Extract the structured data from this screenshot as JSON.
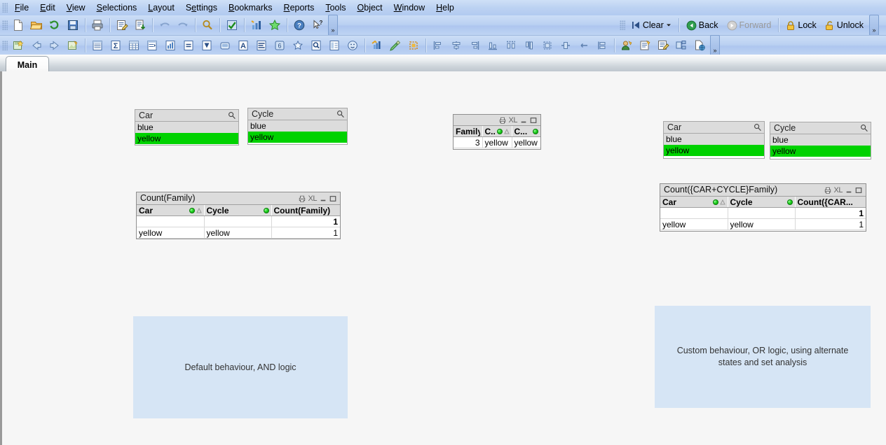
{
  "menubar": {
    "items": [
      {
        "label": "File",
        "accel": "F"
      },
      {
        "label": "Edit",
        "accel": "E"
      },
      {
        "label": "View",
        "accel": "V"
      },
      {
        "label": "Selections",
        "accel": "S"
      },
      {
        "label": "Layout",
        "accel": "L"
      },
      {
        "label": "Settings",
        "accel": "S"
      },
      {
        "label": "Bookmarks",
        "accel": "B"
      },
      {
        "label": "Reports",
        "accel": "R"
      },
      {
        "label": "Tools",
        "accel": "T"
      },
      {
        "label": "Object",
        "accel": "O"
      },
      {
        "label": "Window",
        "accel": "W"
      },
      {
        "label": "Help",
        "accel": "H"
      }
    ]
  },
  "toolbar_standard": {
    "buttons": [
      {
        "name": "new-document-icon",
        "title": "New"
      },
      {
        "name": "open-document-icon",
        "title": "Open"
      },
      {
        "name": "reload-icon",
        "title": "Reload"
      },
      {
        "name": "save-icon",
        "title": "Save"
      },
      {
        "name": "print-icon",
        "title": "Print"
      },
      {
        "name": "edit-script-icon",
        "title": "Edit Script"
      },
      {
        "name": "export-icon",
        "title": "Export"
      },
      {
        "name": "undo-icon",
        "title": "Undo"
      },
      {
        "name": "redo-icon",
        "title": "Redo"
      },
      {
        "name": "search-icon",
        "title": "Search"
      },
      {
        "name": "select-possible-icon",
        "title": "Select Possible"
      },
      {
        "name": "quick-chart-icon",
        "title": "Quick Chart Wizard"
      },
      {
        "name": "favorites-icon",
        "title": "Add Bookmark"
      },
      {
        "name": "help-icon",
        "title": "Help"
      },
      {
        "name": "context-help-icon",
        "title": "Context Help"
      }
    ],
    "overflow_label": "»"
  },
  "selection_toolbar": {
    "clear_label": "Clear",
    "back_label": "Back",
    "forward_label": "Forward",
    "lock_label": "Lock",
    "unlock_label": "Unlock",
    "overflow_label": "»"
  },
  "toolbar_design": {
    "buttons": [
      {
        "name": "new-sheet-icon",
        "title": "New Sheet"
      },
      {
        "name": "promote-sheet-icon",
        "title": "Promote Sheet"
      },
      {
        "name": "demote-sheet-icon",
        "title": "Demote Sheet"
      },
      {
        "name": "sheet-properties-icon",
        "title": "Sheet Properties"
      },
      {
        "name": "new-listbox-icon",
        "title": "List Box"
      },
      {
        "name": "new-statistics-box-icon",
        "title": "Statistics Box"
      },
      {
        "name": "new-table-box-icon",
        "title": "Table Box"
      },
      {
        "name": "new-multi-box-icon",
        "title": "Multi Box"
      },
      {
        "name": "new-chart-icon",
        "title": "Chart"
      },
      {
        "name": "new-input-box-icon",
        "title": "Input Box"
      },
      {
        "name": "new-current-selections-icon",
        "title": "Current Selections Box"
      },
      {
        "name": "new-button-icon",
        "title": "Button"
      },
      {
        "name": "new-text-object-icon",
        "title": "Text Object"
      },
      {
        "name": "new-line-arrow-icon",
        "title": "Line/Arrow Object"
      },
      {
        "name": "new-slider-icon",
        "title": "Slider/Calendar Object"
      },
      {
        "name": "new-bookmark-object-icon",
        "title": "Bookmark Object"
      },
      {
        "name": "new-search-object-icon",
        "title": "Search Object"
      },
      {
        "name": "new-container-icon",
        "title": "Container"
      },
      {
        "name": "new-custom-object-icon",
        "title": "Custom Object"
      },
      {
        "name": "expression-overview-icon",
        "title": "Expression Overview"
      },
      {
        "name": "design-grid-icon",
        "title": "Design Grid"
      },
      {
        "name": "snap-to-grid-icon",
        "title": "Snap To Grid"
      },
      {
        "name": "align-left-icon",
        "title": "Align Left"
      },
      {
        "name": "align-center-h-icon",
        "title": "Align Center Horizontally"
      },
      {
        "name": "align-right-icon",
        "title": "Align Right"
      },
      {
        "name": "align-bottom-icon",
        "title": "Align Bottom"
      },
      {
        "name": "distribute-h-icon",
        "title": "Distribute Horizontally"
      },
      {
        "name": "align-top-icon",
        "title": "Align Top"
      },
      {
        "name": "same-height-icon",
        "title": "Same Height"
      },
      {
        "name": "same-width-icon",
        "title": "Same Width"
      },
      {
        "name": "space-equally-h-icon",
        "title": "Space Equally Horizontally"
      },
      {
        "name": "space-equally-v-icon",
        "title": "Space Equally Vertically"
      },
      {
        "name": "user-icon",
        "title": "User Preferences"
      },
      {
        "name": "document-properties-icon",
        "title": "Document Properties"
      },
      {
        "name": "sheet-props-icon",
        "title": "Sheet Properties"
      },
      {
        "name": "object-layout-icon",
        "title": "Object Layout"
      },
      {
        "name": "publish-icon",
        "title": "Publish"
      }
    ],
    "overflow_label": "»"
  },
  "tabs": [
    {
      "label": "Main",
      "active": true
    }
  ],
  "sheet": {
    "listboxes": [
      {
        "id": "car-default",
        "title": "Car",
        "rows": [
          {
            "value": "blue",
            "state": "optional"
          },
          {
            "value": "yellow",
            "state": "selected"
          }
        ]
      },
      {
        "id": "cycle-default",
        "title": "Cycle",
        "rows": [
          {
            "value": "blue",
            "state": "optional"
          },
          {
            "value": "yellow",
            "state": "selected"
          }
        ]
      },
      {
        "id": "car-alternate",
        "title": "Car",
        "rows": [
          {
            "value": "blue",
            "state": "optional"
          },
          {
            "value": "yellow",
            "state": "selected"
          }
        ]
      },
      {
        "id": "cycle-alternate",
        "title": "Cycle",
        "rows": [
          {
            "value": "blue",
            "state": "optional"
          },
          {
            "value": "yellow",
            "state": "selected"
          }
        ]
      }
    ],
    "middle_table": {
      "title": "",
      "columns": [
        {
          "label": "Family",
          "dot": false,
          "sort": false
        },
        {
          "label": "C...",
          "dot": true,
          "sort": true
        },
        {
          "label": "C...",
          "dot": true,
          "sort": false
        }
      ],
      "rows": [
        [
          "3",
          "yellow",
          "yellow"
        ]
      ]
    },
    "left_table": {
      "title": "Count(Family)",
      "columns": [
        {
          "label": "Car",
          "dot": true,
          "sort": true
        },
        {
          "label": "Cycle",
          "dot": true,
          "sort": false
        },
        {
          "label": "Count(Family)",
          "dot": false,
          "sort": false
        }
      ],
      "total_row": [
        "",
        "",
        "1"
      ],
      "rows": [
        [
          "yellow",
          "yellow",
          "1"
        ]
      ]
    },
    "right_table": {
      "title": "Count({CAR+CYCLE}Family)",
      "columns": [
        {
          "label": "Car",
          "dot": true,
          "sort": true
        },
        {
          "label": "Cycle",
          "dot": true,
          "sort": false
        },
        {
          "label": "Count({CAR...",
          "dot": false,
          "sort": false
        }
      ],
      "total_row": [
        "",
        "",
        "1"
      ],
      "rows": [
        [
          "yellow",
          "yellow",
          "1"
        ]
      ]
    },
    "text_objects": [
      {
        "id": "note-left",
        "text": "Default behaviour, AND logic"
      },
      {
        "id": "note-right",
        "text": "Custom behaviour, OR logic, using alternate states and set analysis"
      }
    ],
    "caption_icons": {
      "print_label": "print-icon",
      "excel_label": "XL",
      "minimize_label": "minimize-icon",
      "maximize_label": "maximize-icon"
    }
  },
  "colors": {
    "selected_green": "#00d200",
    "optional_gray": "#dcdcdc",
    "note_blue": "#d6e5f5",
    "toolbar_blue": "#bcd2f2",
    "sheet_bg": "#f6f6f6"
  }
}
